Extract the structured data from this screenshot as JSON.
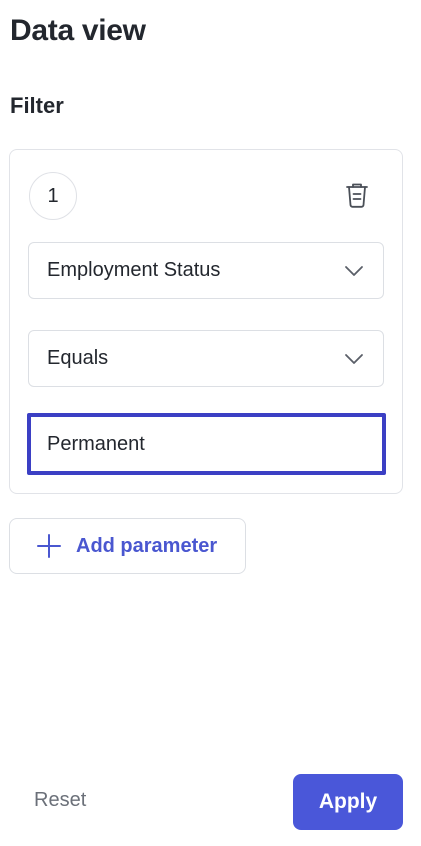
{
  "page": {
    "title": "Data view"
  },
  "filter": {
    "section_title": "Filter",
    "rows": [
      {
        "index": "1",
        "field": "Employment Status",
        "operator": "Equals",
        "value": "Permanent"
      }
    ]
  },
  "actions": {
    "add_parameter": "Add parameter",
    "reset": "Reset",
    "apply": "Apply"
  },
  "icons": {
    "delete": "trash-icon",
    "dropdown": "chevron-down-icon",
    "add": "plus-icon"
  },
  "colors": {
    "accent": "#4a57d9",
    "focus_border": "#3b3fc4",
    "muted_text": "#6b7079"
  }
}
